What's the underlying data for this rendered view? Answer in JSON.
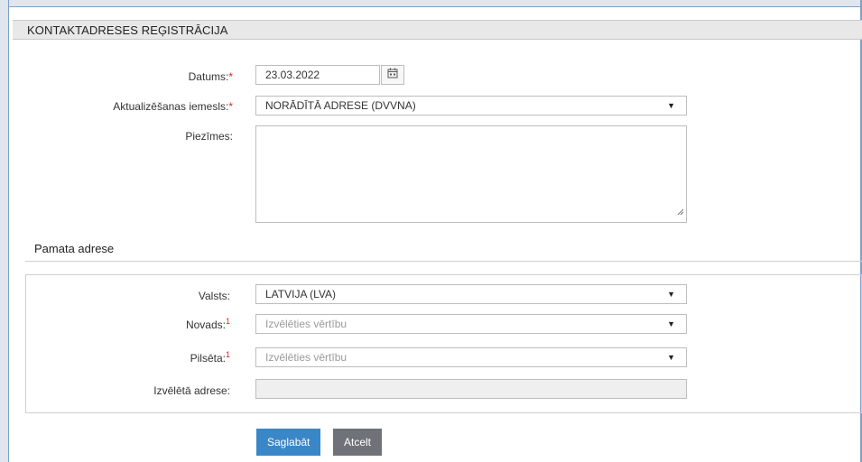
{
  "header": {
    "title": "KONTAKTADRESES REĢISTRĀCIJA"
  },
  "form": {
    "date": {
      "label": "Datums:",
      "required_mark": "*",
      "value": "23.03.2022"
    },
    "reason": {
      "label": "Aktualizēšanas iemesls:",
      "required_mark": "*",
      "value": "NORĀDĪTĀ ADRESE (DVVNA)"
    },
    "notes": {
      "label": "Piezīmes:",
      "value": ""
    }
  },
  "address": {
    "section_title": "Pamata adrese",
    "country": {
      "label": "Valsts:",
      "value": "LATVIJA (LVA)"
    },
    "county": {
      "label": "Novads:",
      "note_mark": "1",
      "placeholder": "Izvēlēties vērtību"
    },
    "city": {
      "label": "Pilsēta:",
      "note_mark": "1",
      "placeholder": "Izvēlēties vērtību"
    },
    "selected": {
      "label": "Izvēlētā adrese:",
      "value": ""
    }
  },
  "actions": {
    "save_label": "Saglabāt",
    "cancel_label": "Atcelt"
  },
  "icons": {
    "caret": "▼",
    "calendar": "calendar-icon",
    "resize": "resize-grip-icon"
  },
  "colors": {
    "primary_button": "#3a87c8",
    "secondary_button": "#6f7379",
    "required_mark": "#dd2222",
    "frame": "#7fa1c6"
  }
}
